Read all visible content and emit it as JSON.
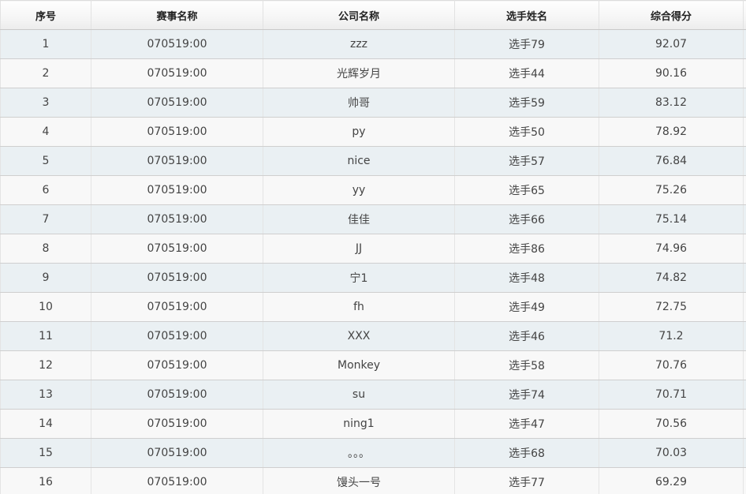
{
  "table": {
    "headers": [
      "序号",
      "赛事名称",
      "公司名称",
      "选手姓名",
      "综合得分"
    ],
    "rows": [
      [
        "1",
        "070519:00",
        "zzz",
        "选手79",
        "92.07"
      ],
      [
        "2",
        "070519:00",
        "光辉岁月",
        "选手44",
        "90.16"
      ],
      [
        "3",
        "070519:00",
        "帅哥",
        "选手59",
        "83.12"
      ],
      [
        "4",
        "070519:00",
        "py",
        "选手50",
        "78.92"
      ],
      [
        "5",
        "070519:00",
        "nice",
        "选手57",
        "76.84"
      ],
      [
        "6",
        "070519:00",
        "yy",
        "选手65",
        "75.26"
      ],
      [
        "7",
        "070519:00",
        "佳佳",
        "选手66",
        "75.14"
      ],
      [
        "8",
        "070519:00",
        "JJ",
        "选手86",
        "74.96"
      ],
      [
        "9",
        "070519:00",
        "宁1",
        "选手48",
        "74.82"
      ],
      [
        "10",
        "070519:00",
        "fh",
        "选手49",
        "72.75"
      ],
      [
        "11",
        "070519:00",
        "XXX",
        "选手46",
        "71.2"
      ],
      [
        "12",
        "070519:00",
        "Monkey",
        "选手58",
        "70.76"
      ],
      [
        "13",
        "070519:00",
        "su",
        "选手74",
        "70.71"
      ],
      [
        "14",
        "070519:00",
        "ning1",
        "选手47",
        "70.56"
      ],
      [
        "15",
        "070519:00",
        "。。。",
        "选手68",
        "70.03"
      ],
      [
        "16",
        "070519:00",
        "馒头一号",
        "选手77",
        "69.29"
      ]
    ]
  },
  "colors": {
    "header_bg": "#f4f4f4",
    "row_odd_bg": "#eaf0f3",
    "row_even_bg": "#f8f8f8",
    "text": "#444444"
  }
}
